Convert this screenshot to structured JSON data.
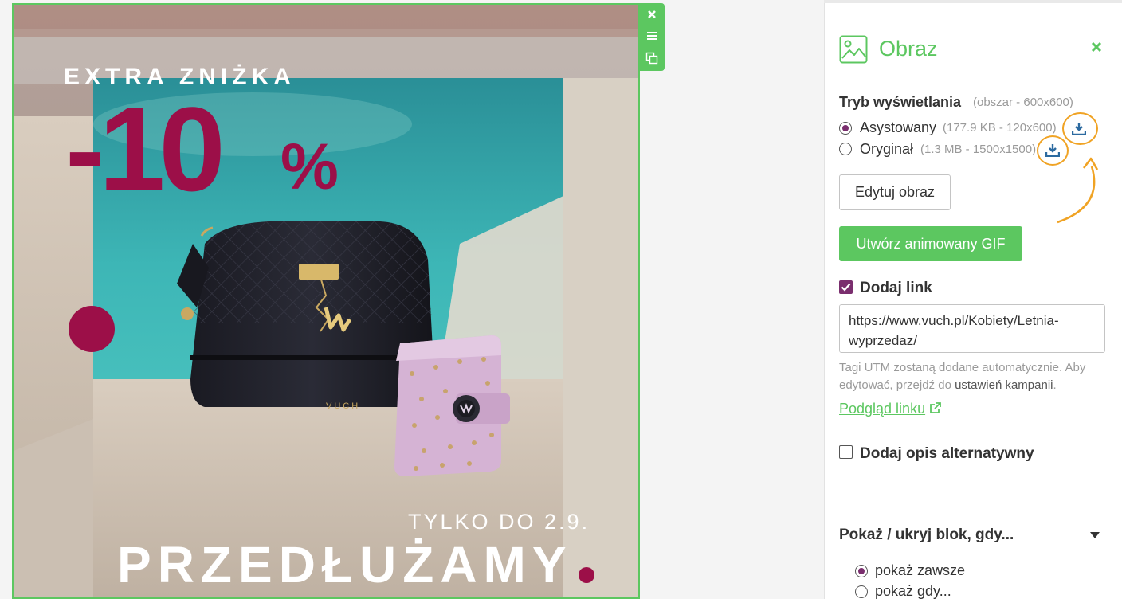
{
  "promo": {
    "extra_label": "EXTRA ZNIŻKA",
    "discount_number": "-10",
    "discount_percent": "%",
    "brand_on_bag": "VUCH",
    "until_text": "TYLKO DO 2.9.",
    "extended_text": "PRZEDŁUŻAMY"
  },
  "panel": {
    "title": "Obraz",
    "display_mode": {
      "label": "Tryb wyświetlania",
      "area_note": "(obszar - 600x600)",
      "options": [
        {
          "label": "Asystowany",
          "detail": "(177.9 KB - 120x600)",
          "selected": true
        },
        {
          "label": "Oryginał",
          "detail": "(1.3 MB - 1500x1500)",
          "selected": false
        }
      ]
    },
    "edit_button": "Edytuj obraz",
    "gif_button": "Utwórz animowany GIF",
    "add_link": {
      "label": "Dodaj link",
      "checked": true
    },
    "link_url": "https://www.vuch.pl/Kobiety/Letnia-wyprzedaz/",
    "utm_note_1": "Tagi UTM zostaną dodane automatycznie. Aby",
    "utm_note_2": "edytować, przejdź do",
    "utm_link": "ustawień kampanii",
    "utm_note_end": ".",
    "preview_link": "Podgląd linku",
    "alt_text": {
      "label": "Dodaj opis alternatywny",
      "checked": false
    },
    "visibility": {
      "label": "Pokaż / ukryj blok, gdy...",
      "options": [
        {
          "label": "pokaż zawsze",
          "selected": true
        },
        {
          "label": "pokaż gdy...",
          "selected": false
        }
      ]
    }
  },
  "colors": {
    "accent_green": "#5cc760",
    "brand_plum": "#7a2e6e",
    "promo_crimson": "#9c0f48",
    "highlight_orange": "#f0a324",
    "download_blue": "#2c6aa0"
  },
  "icons": [
    "close-icon",
    "menu-icon",
    "duplicate-icon",
    "image-icon",
    "download-icon",
    "external-link-icon",
    "triangle-down-icon"
  ]
}
